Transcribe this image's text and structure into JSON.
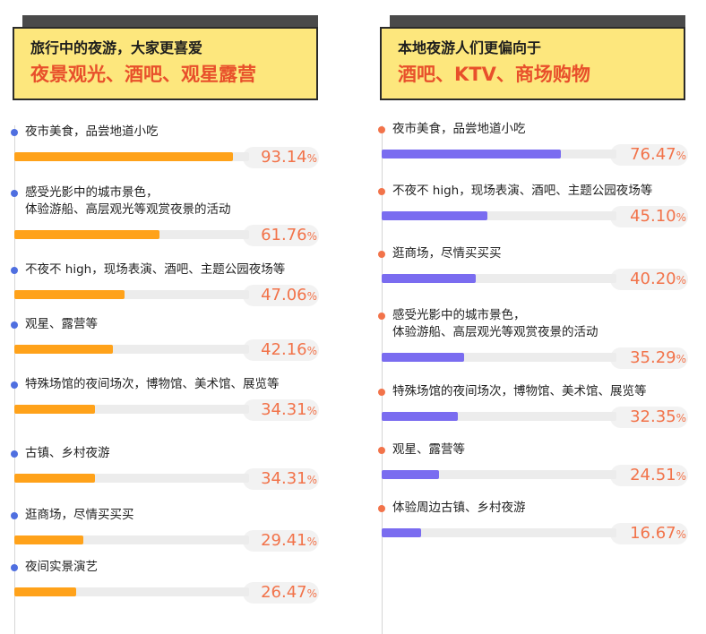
{
  "colors": {
    "header_bg": "#fde77d",
    "header_emphasis": "#e8502b",
    "left_bar": "#ffa21a",
    "right_bar": "#7a6cf0",
    "left_dot": "#4f6fe0",
    "right_dot": "#f2734a",
    "percent_text": "#f2734a"
  },
  "chart_data": [
    {
      "type": "bar",
      "orientation": "horizontal",
      "title": "旅行中的夜游，大家更喜爱",
      "subtitle": "夜景观光、酒吧、观星露营",
      "value_suffix": "%",
      "categories": [
        "夜市美食，品尝地道小吃",
        "感受光影中的城市景色，\n体验游船、高层观光等观赏夜景的活动",
        "不夜不 high，现场表演、酒吧、主题公园夜场等",
        "观星、露营等",
        "特殊场馆的夜间场次，博物馆、美术馆、展览等",
        "古镇、乡村夜游",
        "逛商场，尽情买买买",
        "夜间实景演艺"
      ],
      "values": [
        93.14,
        61.76,
        47.06,
        42.16,
        34.31,
        34.31,
        29.41,
        26.47
      ],
      "value_labels": [
        "93.14",
        "61.76",
        "47.06",
        "42.16",
        "34.31",
        "34.31",
        "29.41",
        "26.47"
      ],
      "xlim": [
        0,
        100
      ],
      "grid": false,
      "legend": "none"
    },
    {
      "type": "bar",
      "orientation": "horizontal",
      "title": "本地夜游人们更偏向于",
      "subtitle": "酒吧、KTV、商场购物",
      "value_suffix": "%",
      "categories": [
        "夜市美食，品尝地道小吃",
        "不夜不 high，现场表演、酒吧、主题公园夜场等",
        "逛商场，尽情买买买",
        "感受光影中的城市景色，\n体验游船、高层观光等观赏夜景的活动",
        "特殊场馆的夜间场次，博物馆、美术馆、展览等",
        "观星、露营等",
        "体验周边古镇、乡村夜游"
      ],
      "values": [
        76.47,
        45.1,
        40.2,
        35.29,
        32.35,
        24.51,
        16.67
      ],
      "value_labels": [
        "76.47",
        "45.10",
        "40.20",
        "35.29",
        "32.35",
        "24.51",
        "16.67"
      ],
      "xlim": [
        0,
        100
      ],
      "grid": false,
      "legend": "none"
    }
  ]
}
